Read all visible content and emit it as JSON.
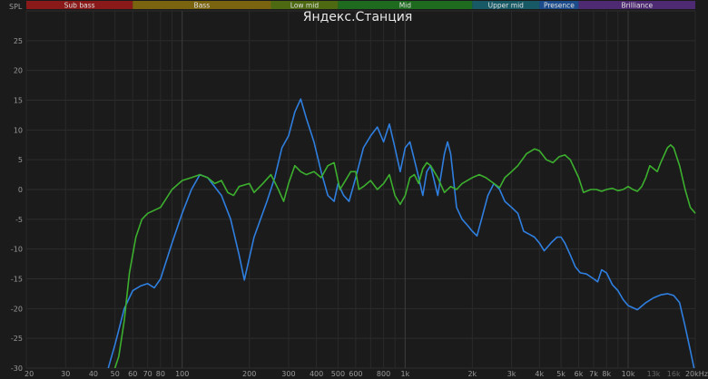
{
  "chart_data": {
    "type": "line",
    "title": "Яндекс.Станция",
    "ylabel": "SPL",
    "x_scale": "log",
    "xlim": [
      20,
      20000
    ],
    "ylim": [
      -30,
      30
    ],
    "grid": true,
    "x_ticks": [
      {
        "v": 20,
        "label": "20"
      },
      {
        "v": 30,
        "label": "30"
      },
      {
        "v": 40,
        "label": "40"
      },
      {
        "v": 50,
        "label": "50"
      },
      {
        "v": 60,
        "label": "60"
      },
      {
        "v": 70,
        "label": "70"
      },
      {
        "v": 80,
        "label": "80"
      },
      {
        "v": 100,
        "label": "100"
      },
      {
        "v": 200,
        "label": "200"
      },
      {
        "v": 300,
        "label": "300"
      },
      {
        "v": 400,
        "label": "400"
      },
      {
        "v": 500,
        "label": "500"
      },
      {
        "v": 600,
        "label": "600"
      },
      {
        "v": 800,
        "label": "800"
      },
      {
        "v": 1000,
        "label": "1k"
      },
      {
        "v": 2000,
        "label": "2k"
      },
      {
        "v": 3000,
        "label": "3k"
      },
      {
        "v": 4000,
        "label": "4k"
      },
      {
        "v": 5000,
        "label": "5k"
      },
      {
        "v": 6000,
        "label": "6k"
      },
      {
        "v": 7000,
        "label": "7k"
      },
      {
        "v": 8000,
        "label": "8k"
      },
      {
        "v": 10000,
        "label": "10k"
      },
      {
        "v": 13000,
        "label": "13k",
        "dim": true
      },
      {
        "v": 16000,
        "label": "16k",
        "dim": true
      },
      {
        "v": 20000,
        "label": "20kHz"
      }
    ],
    "y_ticks": [
      25,
      20,
      15,
      10,
      5,
      0,
      -5,
      -10,
      -15,
      -20,
      -25,
      -30
    ],
    "bands": [
      {
        "name": "Sub bass",
        "from": 20,
        "to": 60,
        "color": "#8a1a1a"
      },
      {
        "name": "Bass",
        "from": 60,
        "to": 250,
        "color": "#7a6410"
      },
      {
        "name": "Low mid",
        "from": 250,
        "to": 500,
        "color": "#4d6a12"
      },
      {
        "name": "Mid",
        "from": 500,
        "to": 2000,
        "color": "#1e6a1e"
      },
      {
        "name": "Upper mid",
        "from": 2000,
        "to": 4000,
        "color": "#175a66"
      },
      {
        "name": "Presence",
        "from": 4000,
        "to": 6000,
        "color": "#1c4c8c"
      },
      {
        "name": "Brilliance",
        "from": 6000,
        "to": 20000,
        "color": "#4e2a72"
      }
    ],
    "series": [
      {
        "color": "#2f7fe0",
        "points": [
          [
            45,
            -32
          ],
          [
            50,
            -26
          ],
          [
            55,
            -20
          ],
          [
            60,
            -17
          ],
          [
            65,
            -16.2
          ],
          [
            70,
            -15.8
          ],
          [
            75,
            -16.5
          ],
          [
            80,
            -15
          ],
          [
            90,
            -9
          ],
          [
            100,
            -4
          ],
          [
            110,
            0
          ],
          [
            120,
            2.5
          ],
          [
            130,
            2
          ],
          [
            150,
            -1
          ],
          [
            165,
            -5
          ],
          [
            180,
            -11
          ],
          [
            190,
            -15.2
          ],
          [
            210,
            -8
          ],
          [
            240,
            -2
          ],
          [
            260,
            2
          ],
          [
            280,
            7
          ],
          [
            300,
            9
          ],
          [
            320,
            13
          ],
          [
            340,
            15.2
          ],
          [
            360,
            12
          ],
          [
            390,
            8
          ],
          [
            420,
            3
          ],
          [
            450,
            -1
          ],
          [
            480,
            -2
          ],
          [
            500,
            1
          ],
          [
            530,
            -1
          ],
          [
            560,
            -2
          ],
          [
            600,
            2
          ],
          [
            650,
            7
          ],
          [
            700,
            9
          ],
          [
            750,
            10.5
          ],
          [
            800,
            8
          ],
          [
            850,
            11
          ],
          [
            900,
            7
          ],
          [
            950,
            3
          ],
          [
            1000,
            7
          ],
          [
            1050,
            8
          ],
          [
            1100,
            5
          ],
          [
            1150,
            2
          ],
          [
            1200,
            -1
          ],
          [
            1250,
            3
          ],
          [
            1300,
            4
          ],
          [
            1400,
            -1
          ],
          [
            1500,
            6
          ],
          [
            1550,
            8
          ],
          [
            1600,
            6
          ],
          [
            1700,
            -3
          ],
          [
            1800,
            -5
          ],
          [
            1900,
            -6
          ],
          [
            2000,
            -7
          ],
          [
            2100,
            -7.8
          ],
          [
            2200,
            -5
          ],
          [
            2350,
            -1
          ],
          [
            2500,
            1
          ],
          [
            2650,
            0
          ],
          [
            2800,
            -2
          ],
          [
            3000,
            -3
          ],
          [
            3200,
            -4
          ],
          [
            3400,
            -7
          ],
          [
            3600,
            -7.5
          ],
          [
            3800,
            -8
          ],
          [
            4000,
            -9
          ],
          [
            4200,
            -10.3
          ],
          [
            4500,
            -9
          ],
          [
            4800,
            -8
          ],
          [
            5000,
            -8
          ],
          [
            5200,
            -9
          ],
          [
            5500,
            -11
          ],
          [
            5800,
            -13
          ],
          [
            6100,
            -14
          ],
          [
            6500,
            -14.2
          ],
          [
            7000,
            -15
          ],
          [
            7300,
            -15.5
          ],
          [
            7600,
            -13.5
          ],
          [
            8000,
            -14
          ],
          [
            8500,
            -16
          ],
          [
            9000,
            -17
          ],
          [
            9500,
            -18.5
          ],
          [
            10000,
            -19.5
          ],
          [
            11000,
            -20.2
          ],
          [
            12000,
            -19
          ],
          [
            13000,
            -18.2
          ],
          [
            14000,
            -17.7
          ],
          [
            15000,
            -17.5
          ],
          [
            16000,
            -17.8
          ],
          [
            17000,
            -19
          ],
          [
            18000,
            -23
          ],
          [
            19000,
            -27
          ],
          [
            20000,
            -31
          ]
        ]
      },
      {
        "color": "#3cb02e",
        "points": [
          [
            48,
            -32
          ],
          [
            52,
            -28
          ],
          [
            55,
            -22
          ],
          [
            58,
            -14
          ],
          [
            62,
            -8
          ],
          [
            66,
            -5
          ],
          [
            70,
            -4
          ],
          [
            80,
            -3
          ],
          [
            90,
            0
          ],
          [
            100,
            1.5
          ],
          [
            110,
            2
          ],
          [
            120,
            2.5
          ],
          [
            130,
            2
          ],
          [
            140,
            1
          ],
          [
            150,
            1.5
          ],
          [
            160,
            -0.5
          ],
          [
            170,
            -1
          ],
          [
            180,
            0.5
          ],
          [
            200,
            1
          ],
          [
            210,
            -0.5
          ],
          [
            230,
            1
          ],
          [
            250,
            2.5
          ],
          [
            270,
            0
          ],
          [
            285,
            -2
          ],
          [
            300,
            1
          ],
          [
            320,
            4
          ],
          [
            340,
            3
          ],
          [
            360,
            2.5
          ],
          [
            390,
            3
          ],
          [
            420,
            2
          ],
          [
            450,
            4
          ],
          [
            480,
            4.5
          ],
          [
            510,
            0
          ],
          [
            540,
            1.5
          ],
          [
            570,
            3
          ],
          [
            600,
            3
          ],
          [
            620,
            0
          ],
          [
            650,
            0.5
          ],
          [
            700,
            1.5
          ],
          [
            750,
            0
          ],
          [
            800,
            1
          ],
          [
            850,
            2.5
          ],
          [
            900,
            -1
          ],
          [
            950,
            -2.5
          ],
          [
            1000,
            -1
          ],
          [
            1050,
            2
          ],
          [
            1100,
            2.5
          ],
          [
            1150,
            1
          ],
          [
            1200,
            3.5
          ],
          [
            1250,
            4.5
          ],
          [
            1300,
            4
          ],
          [
            1400,
            2
          ],
          [
            1500,
            -0.5
          ],
          [
            1600,
            0.5
          ],
          [
            1700,
            0
          ],
          [
            1800,
            1
          ],
          [
            1900,
            1.5
          ],
          [
            2000,
            2
          ],
          [
            2150,
            2.5
          ],
          [
            2300,
            2
          ],
          [
            2500,
            1
          ],
          [
            2650,
            0.3
          ],
          [
            2800,
            2
          ],
          [
            3000,
            3
          ],
          [
            3200,
            4
          ],
          [
            3500,
            6
          ],
          [
            3800,
            6.8
          ],
          [
            4000,
            6.5
          ],
          [
            4300,
            5
          ],
          [
            4600,
            4.5
          ],
          [
            4900,
            5.5
          ],
          [
            5200,
            5.8
          ],
          [
            5500,
            5
          ],
          [
            6000,
            2
          ],
          [
            6300,
            -0.5
          ],
          [
            6800,
            0
          ],
          [
            7200,
            0
          ],
          [
            7600,
            -0.3
          ],
          [
            8000,
            0
          ],
          [
            8500,
            0.2
          ],
          [
            9000,
            -0.2
          ],
          [
            9500,
            0
          ],
          [
            10000,
            0.5
          ],
          [
            10500,
            0
          ],
          [
            11000,
            -0.3
          ],
          [
            11500,
            0.5
          ],
          [
            12000,
            2
          ],
          [
            12500,
            4
          ],
          [
            13000,
            3.5
          ],
          [
            13500,
            3
          ],
          [
            14000,
            4.5
          ],
          [
            15000,
            7
          ],
          [
            15500,
            7.5
          ],
          [
            16000,
            7
          ],
          [
            17000,
            4
          ],
          [
            18000,
            0
          ],
          [
            19000,
            -3
          ],
          [
            20000,
            -4
          ]
        ]
      }
    ]
  }
}
